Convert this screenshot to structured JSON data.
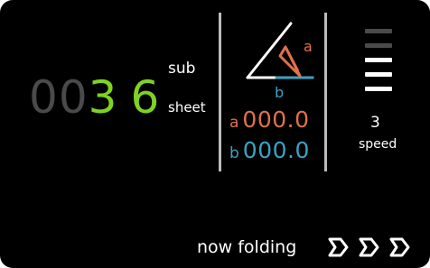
{
  "counter": {
    "digits": [
      "0",
      "0",
      "3",
      "6"
    ],
    "sub_label": "sub",
    "sheet_label": "sheet"
  },
  "fold": {
    "triangle_a_label": "a",
    "triangle_b_label": "b",
    "a_letter": "a",
    "a_value": "000.0",
    "b_letter": "b",
    "b_value": "000.0"
  },
  "speed": {
    "value": "3",
    "label": "speed",
    "level": 3,
    "max_level": 5
  },
  "status": {
    "text": "now folding",
    "indicator_count": 3
  },
  "colors": {
    "panel_bg": "#000000",
    "counter_dim": "#4a4a4a",
    "counter_lit": "#7ed321",
    "a_accent": "#e0714a",
    "b_accent": "#3aa3c3",
    "bar_on": "#ffffff",
    "bar_off": "#4a4a4a"
  }
}
